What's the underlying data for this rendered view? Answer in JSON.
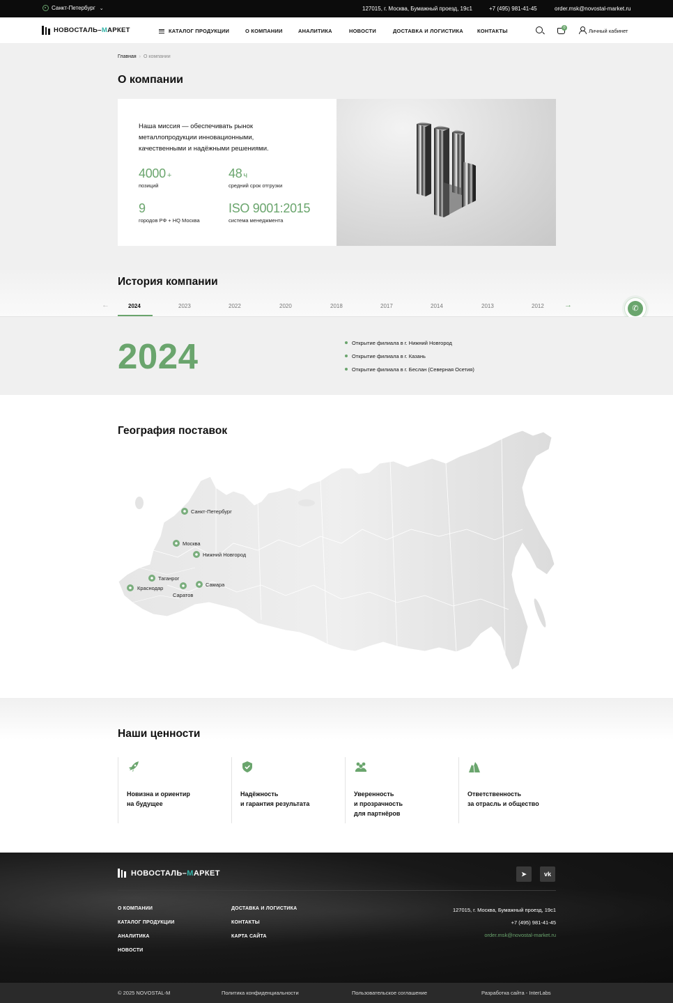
{
  "topbar": {
    "city": "Санкт-Петербург",
    "address": "127015, г. Москва, Бумажный проезд, 19с1",
    "phone": "+7 (495) 981-41-45",
    "email": "order.msk@novostal-market.ru"
  },
  "header": {
    "logo_main": "НОВОСТАЛЬ–",
    "logo_accent": "М",
    "logo_rest": "АРКЕТ",
    "nav": [
      "КАТАЛОГ ПРОДУКЦИИ",
      "О КОМПАНИИ",
      "АНАЛИТИКА",
      "НОВОСТИ",
      "ДОСТАВКА И ЛОГИСТИКА",
      "КОНТАКТЫ"
    ],
    "cart_count": "0",
    "cabinet": "Личный кабинет",
    "icons": [
      "search-icon",
      "cart-icon",
      "user-icon",
      "menu-icon",
      "location-pin-icon"
    ]
  },
  "breadcrumb": {
    "home": "Главная",
    "current": "О компании"
  },
  "about": {
    "title": "О компании",
    "mission": "Наша миссия — обеспечивать рынок металлопродукции инновационными, качественными и надёжными решениями.",
    "stats": [
      {
        "value": "4000",
        "suffix": "+",
        "label": "позиций"
      },
      {
        "value": "48",
        "suffix": "ч",
        "label": "средний срок отгрузки"
      },
      {
        "value": "9",
        "suffix": "",
        "label": "городов РФ + HQ Москва"
      },
      {
        "value": "ISO 9001:2015",
        "suffix": "",
        "label": "система менеджмента"
      }
    ]
  },
  "history": {
    "title": "История компании",
    "years": [
      "2024",
      "2023",
      "2022",
      "2020",
      "2018",
      "2017",
      "2014",
      "2013",
      "2012"
    ],
    "active_year": "2024",
    "events": [
      "Открытие филиала в г. Нижний Новгород",
      "Открытие филиала в г. Казань",
      "Открытие филиала в г. Беслан (Северная Осетия)"
    ]
  },
  "geography": {
    "title": "География поставок",
    "cities": [
      "Санкт-Петербург",
      "Москва",
      "Нижний Новгород",
      "Таганрог",
      "Самара",
      "Краснодар",
      "Саратов"
    ]
  },
  "values": {
    "title": "Наши ценности",
    "items": [
      {
        "icon": "rocket-icon",
        "text": "Новизна и ориентир\nна будущее"
      },
      {
        "icon": "shield-check-icon",
        "text": "Надёжность\nи гарантия результата"
      },
      {
        "icon": "people-icon",
        "text": "Уверенность\nи прозрачность\nдля партнёров"
      },
      {
        "icon": "hands-icon",
        "text": "Ответственность\nза отрасль и общество"
      }
    ]
  },
  "footer": {
    "links_col1": [
      "О КОМПАНИИ",
      "КАТАЛОГ ПРОДУКЦИИ",
      "АНАЛИТИКА",
      "НОВОСТИ"
    ],
    "links_col2": [
      "ДОСТАВКА И ЛОГИСТИКА",
      "КОНТАКТЫ",
      "КАРТА САЙТА"
    ],
    "address": "127015, г. Москва, Бумажный проезд, 19с1",
    "phone": "+7 (495) 981-41-45",
    "email": "order.msk@novostal-market.ru",
    "social": [
      "telegram-icon",
      "vk-icon"
    ],
    "copyright": "© 2025 NOVOSTAL-M",
    "privacy": "Политика конфиденциальности",
    "terms": "Пользовательское соглашение",
    "developer": "Разработка сайта - InterLabs"
  },
  "colors": {
    "accent": "#6aa56d",
    "logo_accent": "#33b3a8",
    "dark": "#0c0c0c"
  }
}
